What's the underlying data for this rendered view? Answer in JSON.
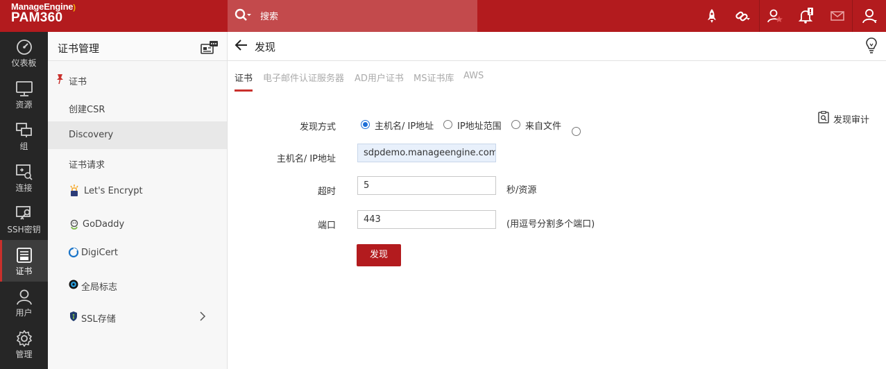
{
  "brand": {
    "company": "ManageEngine",
    "product": "PAM360"
  },
  "search": {
    "placeholder": "搜索"
  },
  "leftnav": [
    {
      "label": "仪表板",
      "icon": "dashboard-icon"
    },
    {
      "label": "资源",
      "icon": "monitor-icon"
    },
    {
      "label": "组",
      "icon": "group-icon"
    },
    {
      "label": "连接",
      "icon": "connection-icon"
    },
    {
      "label": "SSH密钥",
      "icon": "ssh-key-icon"
    },
    {
      "label": "证书",
      "icon": "certificate-icon",
      "active": true
    },
    {
      "label": "用户",
      "icon": "user-icon"
    },
    {
      "label": "管理",
      "icon": "gear-icon"
    }
  ],
  "sidebar": {
    "title": "证书管理",
    "items": [
      {
        "label": "证书",
        "icon": "pin-icon"
      },
      {
        "label": "创建CSR"
      },
      {
        "label": "Discovery",
        "active": true
      },
      {
        "label": "证书请求"
      },
      {
        "label": "Let's Encrypt",
        "icon": "lets-encrypt-icon"
      },
      {
        "label": "GoDaddy",
        "icon": "godaddy-icon"
      },
      {
        "label": "DigiCert",
        "icon": "digicert-icon"
      },
      {
        "label": "全局标志",
        "icon": "globalsign-icon"
      },
      {
        "label": "SSL存储",
        "icon": "ssl-store-icon"
      }
    ]
  },
  "main": {
    "title": "发现",
    "tabs": [
      {
        "label": "证书",
        "active": true
      },
      {
        "label": "电子邮件认证服务器"
      },
      {
        "label": "AD用户证书"
      },
      {
        "label": "MS证书库"
      },
      {
        "label": "AWS"
      }
    ],
    "audit_label": "发现审计",
    "form": {
      "method_label": "发现方式",
      "method_options": [
        {
          "label": "主机名/ IP地址",
          "checked": true
        },
        {
          "label": "IP地址范围",
          "checked": false
        },
        {
          "label": "来自文件",
          "checked": false
        },
        {
          "label": "",
          "checked": false
        }
      ],
      "host_label": "主机名/ IP地址",
      "host_value": "sdpdemo.manageengine.com.",
      "timeout_label": "超时",
      "timeout_value": "5",
      "timeout_hint": "秒/资源",
      "port_label": "端口",
      "port_value": "443",
      "port_hint": "(用逗号分割多个端口)",
      "submit_label": "发现"
    }
  },
  "colors": {
    "brand_red": "#b31b1e",
    "accent_blue": "#1e6fd8",
    "nav_dark": "#262626"
  }
}
